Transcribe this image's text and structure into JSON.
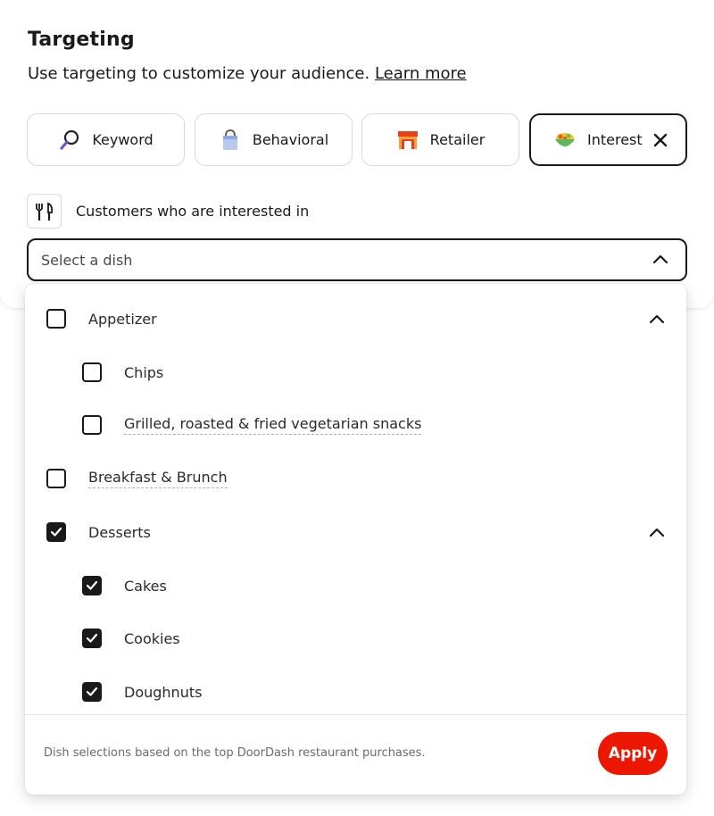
{
  "header": {
    "title": "Targeting",
    "subtitle": "Use targeting to customize your audience.",
    "learn_more": "Learn more"
  },
  "chips": [
    {
      "label": "Keyword",
      "icon": "magnifier-icon"
    },
    {
      "label": "Behavioral",
      "icon": "shopping-bag-icon"
    },
    {
      "label": "Retailer",
      "icon": "store-icon"
    },
    {
      "label": "Interest",
      "icon": "salad-bowl-icon",
      "selected": true
    }
  ],
  "rule": {
    "icon": "fork-knife-icon",
    "label": "Customers who are interested in"
  },
  "select": {
    "placeholder": "Select a dish",
    "expanded": true
  },
  "dropdown": {
    "options": [
      {
        "label": "Appetizer",
        "checked": false,
        "level": 0,
        "expandable": true
      },
      {
        "label": "Chips",
        "checked": false,
        "level": 1
      },
      {
        "label": "Grilled, roasted & fried vegetarian snacks",
        "checked": false,
        "level": 1
      },
      {
        "label": "Breakfast & Brunch",
        "checked": false,
        "level": 0
      },
      {
        "label": "Desserts",
        "checked": true,
        "level": 0,
        "expandable": true
      },
      {
        "label": "Cakes",
        "checked": true,
        "level": 1
      },
      {
        "label": "Cookies",
        "checked": true,
        "level": 1
      },
      {
        "label": "Doughnuts",
        "checked": true,
        "level": 1
      }
    ],
    "footer_note": "Dish selections based on the top DoorDash restaurant purchases.",
    "apply_label": "Apply"
  },
  "colors": {
    "accent": "#eb1700",
    "text": "#191919",
    "border": "#d9d9d9"
  }
}
